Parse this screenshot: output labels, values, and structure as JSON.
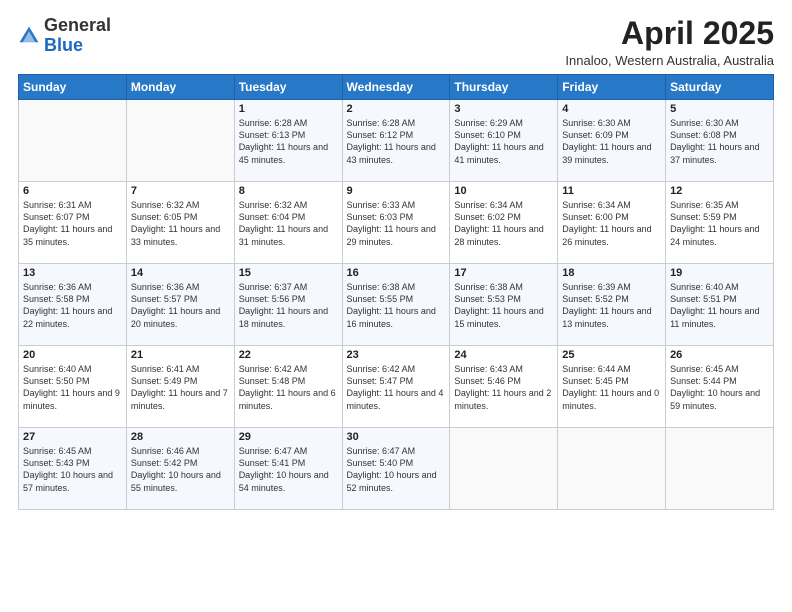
{
  "logo": {
    "general": "General",
    "blue": "Blue"
  },
  "header": {
    "title": "April 2025",
    "subtitle": "Innaloo, Western Australia, Australia"
  },
  "weekdays": [
    "Sunday",
    "Monday",
    "Tuesday",
    "Wednesday",
    "Thursday",
    "Friday",
    "Saturday"
  ],
  "weeks": [
    [
      {
        "day": "",
        "sunrise": "",
        "sunset": "",
        "daylight": ""
      },
      {
        "day": "",
        "sunrise": "",
        "sunset": "",
        "daylight": ""
      },
      {
        "day": "1",
        "sunrise": "Sunrise: 6:28 AM",
        "sunset": "Sunset: 6:13 PM",
        "daylight": "Daylight: 11 hours and 45 minutes."
      },
      {
        "day": "2",
        "sunrise": "Sunrise: 6:28 AM",
        "sunset": "Sunset: 6:12 PM",
        "daylight": "Daylight: 11 hours and 43 minutes."
      },
      {
        "day": "3",
        "sunrise": "Sunrise: 6:29 AM",
        "sunset": "Sunset: 6:10 PM",
        "daylight": "Daylight: 11 hours and 41 minutes."
      },
      {
        "day": "4",
        "sunrise": "Sunrise: 6:30 AM",
        "sunset": "Sunset: 6:09 PM",
        "daylight": "Daylight: 11 hours and 39 minutes."
      },
      {
        "day": "5",
        "sunrise": "Sunrise: 6:30 AM",
        "sunset": "Sunset: 6:08 PM",
        "daylight": "Daylight: 11 hours and 37 minutes."
      }
    ],
    [
      {
        "day": "6",
        "sunrise": "Sunrise: 6:31 AM",
        "sunset": "Sunset: 6:07 PM",
        "daylight": "Daylight: 11 hours and 35 minutes."
      },
      {
        "day": "7",
        "sunrise": "Sunrise: 6:32 AM",
        "sunset": "Sunset: 6:05 PM",
        "daylight": "Daylight: 11 hours and 33 minutes."
      },
      {
        "day": "8",
        "sunrise": "Sunrise: 6:32 AM",
        "sunset": "Sunset: 6:04 PM",
        "daylight": "Daylight: 11 hours and 31 minutes."
      },
      {
        "day": "9",
        "sunrise": "Sunrise: 6:33 AM",
        "sunset": "Sunset: 6:03 PM",
        "daylight": "Daylight: 11 hours and 29 minutes."
      },
      {
        "day": "10",
        "sunrise": "Sunrise: 6:34 AM",
        "sunset": "Sunset: 6:02 PM",
        "daylight": "Daylight: 11 hours and 28 minutes."
      },
      {
        "day": "11",
        "sunrise": "Sunrise: 6:34 AM",
        "sunset": "Sunset: 6:00 PM",
        "daylight": "Daylight: 11 hours and 26 minutes."
      },
      {
        "day": "12",
        "sunrise": "Sunrise: 6:35 AM",
        "sunset": "Sunset: 5:59 PM",
        "daylight": "Daylight: 11 hours and 24 minutes."
      }
    ],
    [
      {
        "day": "13",
        "sunrise": "Sunrise: 6:36 AM",
        "sunset": "Sunset: 5:58 PM",
        "daylight": "Daylight: 11 hours and 22 minutes."
      },
      {
        "day": "14",
        "sunrise": "Sunrise: 6:36 AM",
        "sunset": "Sunset: 5:57 PM",
        "daylight": "Daylight: 11 hours and 20 minutes."
      },
      {
        "day": "15",
        "sunrise": "Sunrise: 6:37 AM",
        "sunset": "Sunset: 5:56 PM",
        "daylight": "Daylight: 11 hours and 18 minutes."
      },
      {
        "day": "16",
        "sunrise": "Sunrise: 6:38 AM",
        "sunset": "Sunset: 5:55 PM",
        "daylight": "Daylight: 11 hours and 16 minutes."
      },
      {
        "day": "17",
        "sunrise": "Sunrise: 6:38 AM",
        "sunset": "Sunset: 5:53 PM",
        "daylight": "Daylight: 11 hours and 15 minutes."
      },
      {
        "day": "18",
        "sunrise": "Sunrise: 6:39 AM",
        "sunset": "Sunset: 5:52 PM",
        "daylight": "Daylight: 11 hours and 13 minutes."
      },
      {
        "day": "19",
        "sunrise": "Sunrise: 6:40 AM",
        "sunset": "Sunset: 5:51 PM",
        "daylight": "Daylight: 11 hours and 11 minutes."
      }
    ],
    [
      {
        "day": "20",
        "sunrise": "Sunrise: 6:40 AM",
        "sunset": "Sunset: 5:50 PM",
        "daylight": "Daylight: 11 hours and 9 minutes."
      },
      {
        "day": "21",
        "sunrise": "Sunrise: 6:41 AM",
        "sunset": "Sunset: 5:49 PM",
        "daylight": "Daylight: 11 hours and 7 minutes."
      },
      {
        "day": "22",
        "sunrise": "Sunrise: 6:42 AM",
        "sunset": "Sunset: 5:48 PM",
        "daylight": "Daylight: 11 hours and 6 minutes."
      },
      {
        "day": "23",
        "sunrise": "Sunrise: 6:42 AM",
        "sunset": "Sunset: 5:47 PM",
        "daylight": "Daylight: 11 hours and 4 minutes."
      },
      {
        "day": "24",
        "sunrise": "Sunrise: 6:43 AM",
        "sunset": "Sunset: 5:46 PM",
        "daylight": "Daylight: 11 hours and 2 minutes."
      },
      {
        "day": "25",
        "sunrise": "Sunrise: 6:44 AM",
        "sunset": "Sunset: 5:45 PM",
        "daylight": "Daylight: 11 hours and 0 minutes."
      },
      {
        "day": "26",
        "sunrise": "Sunrise: 6:45 AM",
        "sunset": "Sunset: 5:44 PM",
        "daylight": "Daylight: 10 hours and 59 minutes."
      }
    ],
    [
      {
        "day": "27",
        "sunrise": "Sunrise: 6:45 AM",
        "sunset": "Sunset: 5:43 PM",
        "daylight": "Daylight: 10 hours and 57 minutes."
      },
      {
        "day": "28",
        "sunrise": "Sunrise: 6:46 AM",
        "sunset": "Sunset: 5:42 PM",
        "daylight": "Daylight: 10 hours and 55 minutes."
      },
      {
        "day": "29",
        "sunrise": "Sunrise: 6:47 AM",
        "sunset": "Sunset: 5:41 PM",
        "daylight": "Daylight: 10 hours and 54 minutes."
      },
      {
        "day": "30",
        "sunrise": "Sunrise: 6:47 AM",
        "sunset": "Sunset: 5:40 PM",
        "daylight": "Daylight: 10 hours and 52 minutes."
      },
      {
        "day": "",
        "sunrise": "",
        "sunset": "",
        "daylight": ""
      },
      {
        "day": "",
        "sunrise": "",
        "sunset": "",
        "daylight": ""
      },
      {
        "day": "",
        "sunrise": "",
        "sunset": "",
        "daylight": ""
      }
    ]
  ]
}
